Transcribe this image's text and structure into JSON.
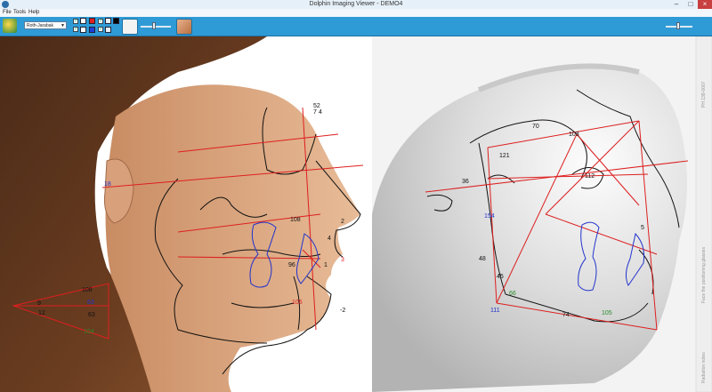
{
  "window": {
    "title": "Dolphin Imaging Viewer - DEMO4"
  },
  "menu": {
    "items": [
      "File",
      "Tools",
      "Help"
    ]
  },
  "toolbar": {
    "analysis_select": {
      "value": "Roth-Jarabak"
    },
    "colors": {
      "accent": "#2f9bd6",
      "swatch_red": "#e02020",
      "swatch_blue": "#1f3fd8",
      "swatch_black": "#000000"
    }
  },
  "photo_measurements": {
    "v18": "18",
    "v108": "108",
    "v2": "2",
    "v4": "4",
    "v96": "96",
    "v1": "1",
    "v3": "3",
    "v105": "105",
    "vm2": "-2",
    "v52": "52",
    "v7": "7",
    "v4b": "4",
    "tri108": "108",
    "tri9": "9",
    "tri63a": "63",
    "tri12": "12",
    "tri63b": "63",
    "tri104": "104"
  },
  "xray_measurements": {
    "v70": "70",
    "v103": "103",
    "v121": "121",
    "v112": "112",
    "v36": "36",
    "v154": "154",
    "v48": "48",
    "v45": "45",
    "v66": "66",
    "v111": "111",
    "v74": "74",
    "v105": "105",
    "v5": "5"
  },
  "xray_side_labels": {
    "top": "PH 138-0007",
    "middle": "Face the positioning glasses",
    "bottom": "Radiation notes"
  },
  "lines": {
    "red": "#dd1f1f",
    "blue": "#2233cc",
    "black": "#111111"
  }
}
